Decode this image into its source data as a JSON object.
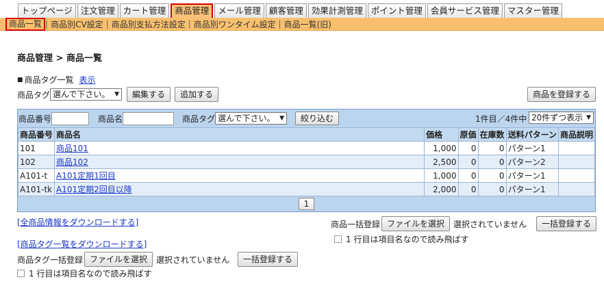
{
  "tabs": [
    "トップページ",
    "注文管理",
    "カート管理",
    "商品管理",
    "メール管理",
    "顧客管理",
    "効果計測管理",
    "ポイント管理",
    "会員サービス管理",
    "マスター管理"
  ],
  "active_tab": 3,
  "subnav": [
    "商品一覧",
    "商品別CV設定",
    "商品別支払方法設定",
    "商品別ワンタイム設定",
    "商品一覧(旧)"
  ],
  "page_title": "商品管理 > 商品一覧",
  "tag_section": {
    "heading": "商品タグ一覧",
    "show_link": "表示",
    "label": "商品タグ",
    "select_value": "選んで下さい。",
    "edit_button": "編集する",
    "add_button": "追加する"
  },
  "register_button": "商品を登録する",
  "filter": {
    "product_no_label": "商品番号",
    "product_name_label": "商品名",
    "tag_label": "商品タグ",
    "tag_select": "選んで下さい。",
    "filter_button": "絞り込む",
    "count_text": "1件目／4件中",
    "per_page": "20件ずつ表示"
  },
  "table": {
    "headers": [
      "商品番号",
      "商品名",
      "価格",
      "原価",
      "在庫数",
      "送料パターン",
      "商品説明"
    ],
    "rows": [
      [
        "101",
        "商品101",
        "1,000",
        "0",
        "0",
        "パターン1",
        ""
      ],
      [
        "102",
        "商品102",
        "2,500",
        "0",
        "0",
        "パターン2",
        ""
      ],
      [
        "A101-t",
        "A101定期1回目",
        "1,000",
        "0",
        "0",
        "パターン1",
        ""
      ],
      [
        "A101-tk",
        "A101定期2回目以降",
        "2,000",
        "0",
        "0",
        "パターン1",
        ""
      ]
    ]
  },
  "pager": "1",
  "download_all": "[全商品情報をダウンロードする]",
  "bulk_product": {
    "label": "商品一括登録",
    "file_button": "ファイルを選択",
    "file_status": "選択されていません",
    "register_button": "一括登録する",
    "skip_label": "1 行目は項目名なので読み飛ばす"
  },
  "download_tags": "[商品タグ一覧をダウンロードする]",
  "bulk_tag": {
    "label": "商品タグ一括登録",
    "file_button": "ファイルを選択",
    "file_status": "選択されていません",
    "register_button": "一括登録する",
    "skip_label": "1 行目は項目名なので読み飛ばす"
  }
}
